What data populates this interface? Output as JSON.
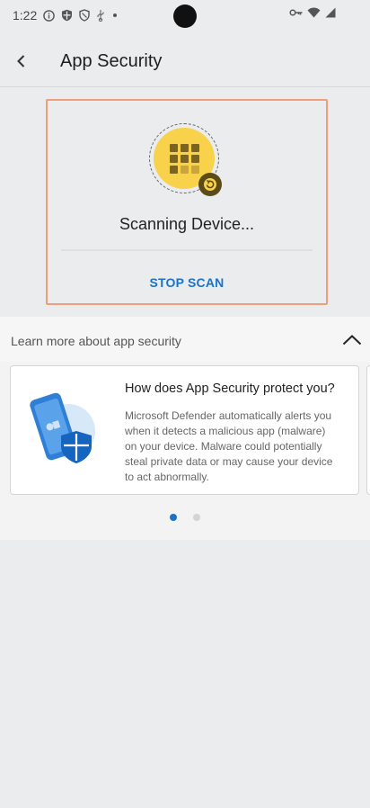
{
  "status_bar": {
    "time": "1:22"
  },
  "app_bar": {
    "title": "App Security"
  },
  "scan": {
    "status": "Scanning Device...",
    "stop_label": "STOP SCAN"
  },
  "learn_more": {
    "title": "Learn more about app security",
    "cards": [
      {
        "title": "How does App Security protect you?",
        "body": "Microsoft Defender automatically alerts you when it detects a malicious app (malware) on your device. Malware could potentially steal private data or may cause your device to act abnormally."
      }
    ],
    "pager": {
      "total": 2,
      "active": 1
    }
  },
  "colors": {
    "accent": "#1a73c9",
    "scan_yellow": "#f7d24a",
    "highlight_border": "#ee9d7d"
  }
}
